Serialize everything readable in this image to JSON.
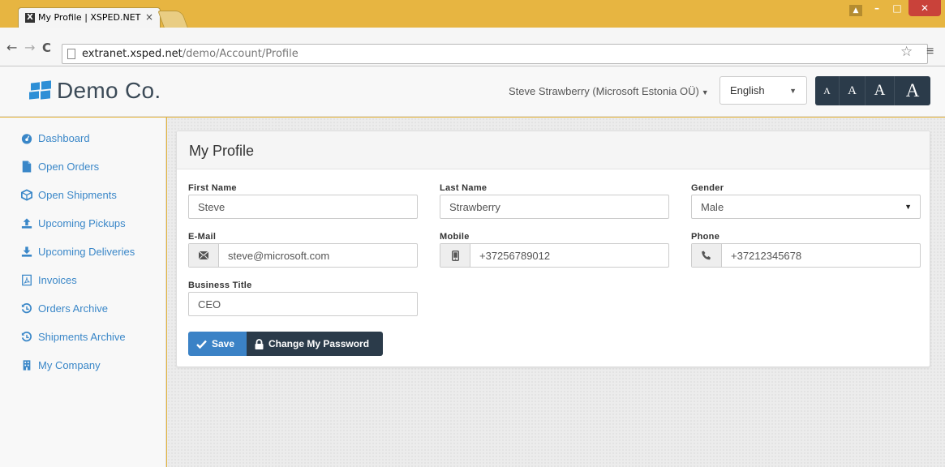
{
  "browser": {
    "tab_title": "My Profile | XSPED.NET",
    "tab_favicon": "X",
    "tab_close": "×",
    "url_host": "extranet.xsped.net",
    "url_path": "/demo/Account/Profile"
  },
  "header": {
    "logo_text": "Demo Co.",
    "user_menu": "Steve Strawberry (Microsoft Estonia OÜ)",
    "language": "English",
    "font_sizes": [
      "A",
      "A",
      "A",
      "A"
    ]
  },
  "sidebar": {
    "items": [
      {
        "label": "Dashboard",
        "icon": "dashboard-icon"
      },
      {
        "label": "Open Orders",
        "icon": "file-icon"
      },
      {
        "label": "Open Shipments",
        "icon": "cube-icon"
      },
      {
        "label": "Upcoming Pickups",
        "icon": "upload-icon"
      },
      {
        "label": "Upcoming Deliveries",
        "icon": "download-icon"
      },
      {
        "label": "Invoices",
        "icon": "pdf-icon"
      },
      {
        "label": "Orders Archive",
        "icon": "history-icon"
      },
      {
        "label": "Shipments Archive",
        "icon": "history-icon"
      },
      {
        "label": "My Company",
        "icon": "building-icon"
      }
    ]
  },
  "profile": {
    "title": "My Profile",
    "first_name_label": "First Name",
    "first_name": "Steve",
    "last_name_label": "Last Name",
    "last_name": "Strawberry",
    "gender_label": "Gender",
    "gender": "Male",
    "email_label": "E-Mail",
    "email": "steve@microsoft.com",
    "mobile_label": "Mobile",
    "mobile": "+37256789012",
    "phone_label": "Phone",
    "phone": "+37212345678",
    "business_title_label": "Business Title",
    "business_title": "CEO",
    "save_label": "Save",
    "change_password_label": "Change My Password"
  },
  "colors": {
    "link": "#3a87c8",
    "primary": "#3b82c6",
    "dark": "#2b3b4a",
    "chrome": "#e7b541"
  }
}
